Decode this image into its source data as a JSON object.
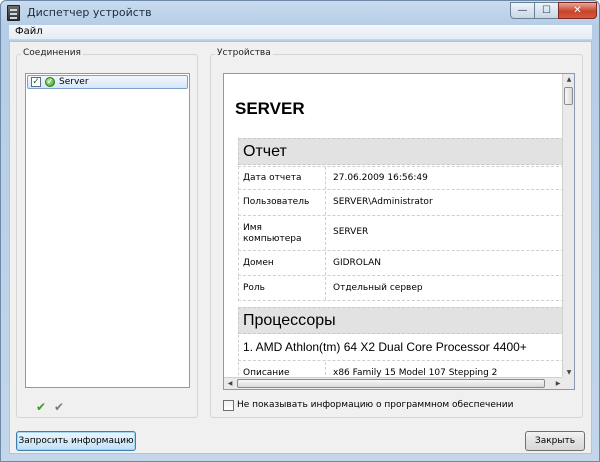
{
  "window": {
    "title": "Диспетчер устройств"
  },
  "menu": {
    "file": "Файл"
  },
  "connections": {
    "label": "Соединения",
    "items": [
      {
        "label": "Server",
        "checked": true,
        "status": "ok"
      }
    ]
  },
  "devices": {
    "label": "Устройства",
    "report": {
      "host": "SERVER",
      "report_section": "Отчет",
      "rows": [
        {
          "key": "Дата отчета",
          "value": "27.06.2009 16:56:49"
        },
        {
          "key": "Пользователь",
          "value": "SERVER\\Administrator"
        },
        {
          "key": "Имя компьютера",
          "value": "SERVER"
        },
        {
          "key": "Домен",
          "value": "GIDROLAN"
        },
        {
          "key": "Роль",
          "value": "Отдельный сервер"
        }
      ],
      "cpu_section": "Процессоры",
      "cpu_name": "1. AMD Athlon(tm) 64 X2 Dual Core Processor 4400+",
      "cpu_rows": [
        {
          "key": "Описание",
          "value": "x86 Family 15 Model 107 Stepping 2"
        }
      ]
    },
    "hide_software_option": "Не показывать информацию о программном обеспечении"
  },
  "buttons": {
    "request": "Запросить информацию",
    "close": "Закрыть"
  },
  "icons": {
    "app": "device-manager-icon",
    "select_all": "check-green-icon",
    "deselect": "check-gray-icon"
  },
  "colors": {
    "accent": "#3c7fb1",
    "close_button": "#c8432a",
    "status_ok": "#2f9a1e"
  }
}
